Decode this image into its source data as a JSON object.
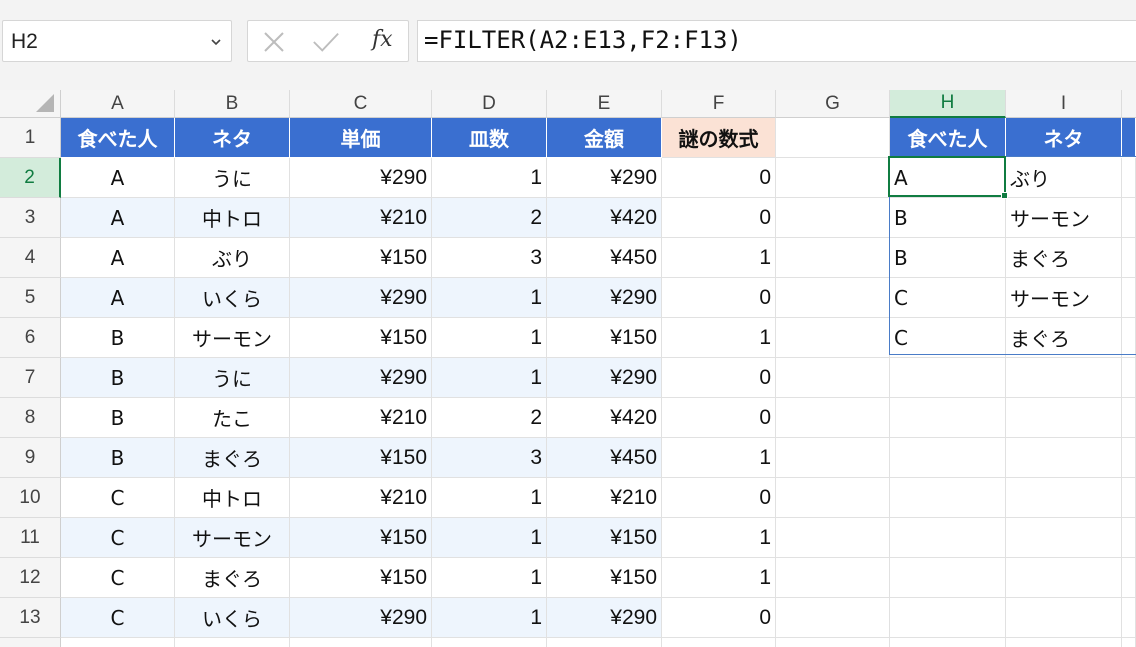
{
  "name_box": {
    "value": "H2"
  },
  "formula_bar": {
    "fx_label": "fx",
    "formula": "=FILTER(A2:E13,F2:F13)"
  },
  "columns": [
    "A",
    "B",
    "C",
    "D",
    "E",
    "F",
    "G",
    "H",
    "I"
  ],
  "rows": [
    "1",
    "2",
    "3",
    "4",
    "5",
    "6",
    "7",
    "8",
    "9",
    "10",
    "11",
    "12",
    "13"
  ],
  "selected": {
    "column": "H",
    "row": "2"
  },
  "table": {
    "headers": [
      "食べた人",
      "ネタ",
      "単価",
      "皿数",
      "金額",
      "謎の数式"
    ],
    "rows": [
      [
        "A",
        "うに",
        "¥290",
        "1",
        "¥290",
        "0"
      ],
      [
        "A",
        "中トロ",
        "¥210",
        "2",
        "¥420",
        "0"
      ],
      [
        "A",
        "ぶり",
        "¥150",
        "3",
        "¥450",
        "1"
      ],
      [
        "A",
        "いくら",
        "¥290",
        "1",
        "¥290",
        "0"
      ],
      [
        "B",
        "サーモン",
        "¥150",
        "1",
        "¥150",
        "1"
      ],
      [
        "B",
        "うに",
        "¥290",
        "1",
        "¥290",
        "0"
      ],
      [
        "B",
        "たこ",
        "¥210",
        "2",
        "¥420",
        "0"
      ],
      [
        "B",
        "まぐろ",
        "¥150",
        "3",
        "¥450",
        "1"
      ],
      [
        "C",
        "中トロ",
        "¥210",
        "1",
        "¥210",
        "0"
      ],
      [
        "C",
        "サーモン",
        "¥150",
        "1",
        "¥150",
        "1"
      ],
      [
        "C",
        "まぐろ",
        "¥150",
        "1",
        "¥150",
        "1"
      ],
      [
        "C",
        "いくら",
        "¥290",
        "1",
        "¥290",
        "0"
      ]
    ]
  },
  "filter_result": {
    "headers": [
      "食べた人",
      "ネタ"
    ],
    "rows": [
      [
        "A",
        "ぶり"
      ],
      [
        "B",
        "サーモン"
      ],
      [
        "B",
        "まぐろ"
      ],
      [
        "C",
        "サーモン"
      ],
      [
        "C",
        "まぐろ"
      ]
    ]
  },
  "colors": {
    "header_blue": "#3a6fd0",
    "header_peach": "#fbe2d5",
    "band": "#eef5fd",
    "selection_green": "#107c41"
  },
  "icons": {
    "cancel": "close-icon",
    "enter": "check-icon",
    "name_box_dropdown": "chevron-down-icon"
  }
}
